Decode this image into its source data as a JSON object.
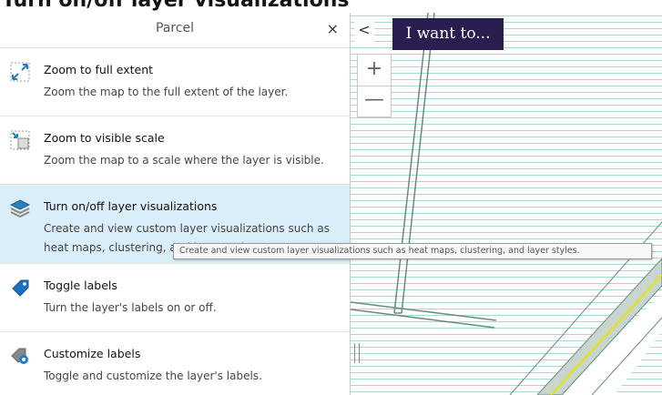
{
  "page_heading": "Turn on/off layer visualizations",
  "panel": {
    "title": "Parcel",
    "close_label": "×",
    "items": [
      {
        "title": "Zoom to full extent",
        "desc": "Zoom the map to the full extent of the layer.",
        "icon": "zoom-full-extent-icon"
      },
      {
        "title": "Zoom to visible scale",
        "desc": "Zoom the map to a scale where the layer is visible.",
        "icon": "zoom-visible-scale-icon"
      },
      {
        "title": "Turn on/off layer visualizations",
        "desc": "Create and view custom layer visualizations such as heat maps, clustering, and layer styles.",
        "icon": "layers-icon"
      },
      {
        "title": "Toggle labels",
        "desc": "Turn the layer's labels on or off.",
        "icon": "label-tag-icon"
      },
      {
        "title": "Customize labels",
        "desc": "Toggle and customize the layer's labels.",
        "icon": "label-settings-icon"
      }
    ]
  },
  "map": {
    "collapse_label": "<",
    "i_want_to_label": "I want to...",
    "zoom_in_label": "+",
    "zoom_out_label": "—"
  },
  "tooltip": {
    "text": "Create and view custom layer visualizations such as heat maps, clustering, and layer styles."
  },
  "colors": {
    "accent": "#2a1d4f",
    "hover_bg": "#d9eef8",
    "hatch": "#a8dcc6",
    "road_line": "#e6e600"
  }
}
